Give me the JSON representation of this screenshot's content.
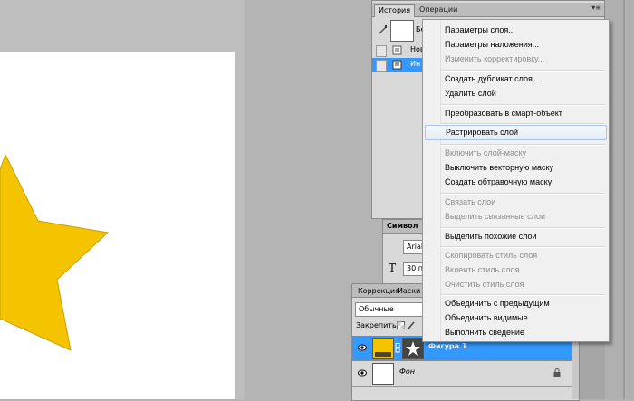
{
  "history_panel": {
    "tabs": [
      "История",
      "Операции"
    ],
    "snapshot_label": "Бе",
    "rows": [
      {
        "label": "Нов",
        "selected": false
      },
      {
        "label": "Ин",
        "selected": true
      }
    ],
    "menu_icon": "panel-menu-icon"
  },
  "symbol_panel": {
    "tab": "Символ",
    "font": "Arial",
    "size": "30 п"
  },
  "layers_panel": {
    "tabs": [
      "Коррекция",
      "Маски"
    ],
    "blend_mode": "Обычные",
    "lock_label": "Закрепить:",
    "layers": [
      {
        "name": "Фигура 1",
        "selected": true,
        "thumb_color": "#f5c400"
      },
      {
        "name": "Фон",
        "selected": false,
        "thumb_color": "#ffffff"
      }
    ]
  },
  "context_menu": {
    "groups": [
      [
        {
          "label": "Параметры слоя...",
          "disabled": false
        },
        {
          "label": "Параметры наложения...",
          "disabled": false
        },
        {
          "label": "Изменить корректировку...",
          "disabled": true
        }
      ],
      [
        {
          "label": "Создать дубликат слоя...",
          "disabled": false
        },
        {
          "label": "Удалить слой",
          "disabled": false
        }
      ],
      [
        {
          "label": "Преобразовать в смарт-объект",
          "disabled": false
        }
      ],
      [
        {
          "label": "Растрировать слой",
          "disabled": false,
          "highlighted": true
        }
      ],
      [
        {
          "label": "Включить слой-маску",
          "disabled": true
        },
        {
          "label": "Выключить векторную маску",
          "disabled": false
        },
        {
          "label": "Создать обтравочную маску",
          "disabled": false
        }
      ],
      [
        {
          "label": "Связать слои",
          "disabled": true
        },
        {
          "label": "Выделить связанные слои",
          "disabled": true
        }
      ],
      [
        {
          "label": "Выделить похожие слои",
          "disabled": false
        }
      ],
      [
        {
          "label": "Скопировать стиль слоя",
          "disabled": true
        },
        {
          "label": "Вклеить стиль слоя",
          "disabled": true
        },
        {
          "label": "Очистить стиль слоя",
          "disabled": true
        }
      ],
      [
        {
          "label": "Объединить с предыдущим",
          "disabled": false
        },
        {
          "label": "Объединить видимые",
          "disabled": false
        },
        {
          "label": "Выполнить сведение",
          "disabled": false
        }
      ]
    ]
  },
  "colors": {
    "star_fill": "#f5c400",
    "selection": "#3399ff",
    "menu_highlight_border": "#a8c4e8"
  }
}
